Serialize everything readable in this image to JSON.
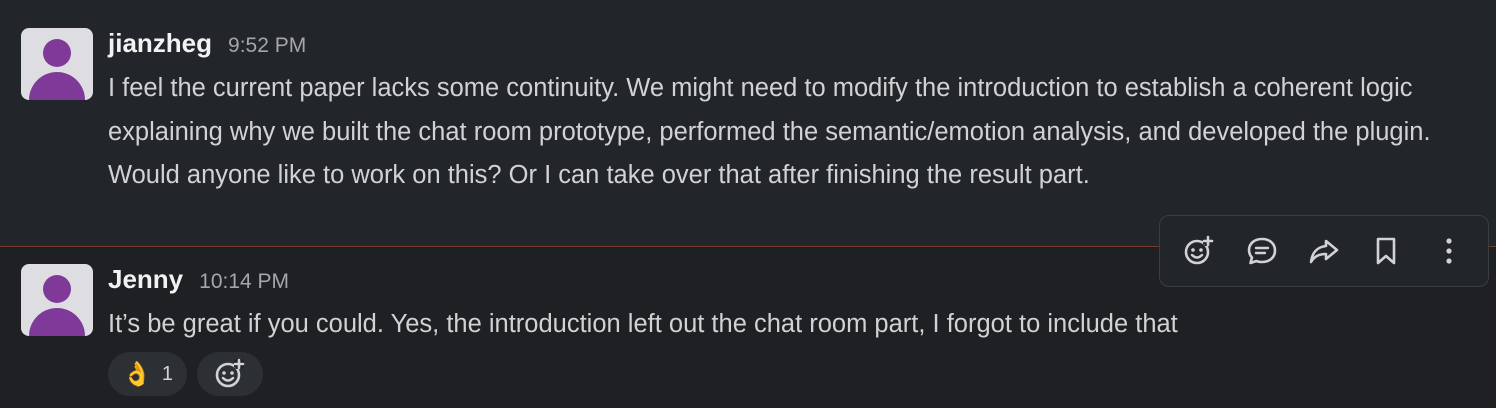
{
  "messages": [
    {
      "author": "jianzheg",
      "time": "9:52 PM",
      "text": "I feel the current paper lacks some continuity. We might need to modify the introduction to establish a coherent logic explaining why we built the chat room prototype, performed the semantic/emotion analysis, and developed the plugin. Would anyone like to work on this? Or I can take over that after finishing the result part."
    },
    {
      "author": "Jenny",
      "time": "10:14 PM",
      "text": "It’s be great if you could. Yes, the introduction left out the chat room part, I forgot to include that",
      "reactions": [
        {
          "emoji": "👌",
          "count": "1"
        }
      ]
    }
  ],
  "toolbar_icons": [
    "add-reaction-icon",
    "reply-in-thread-icon",
    "forward-icon",
    "save-bookmark-icon",
    "more-actions-icon"
  ],
  "colors": {
    "background": "#1a1d21",
    "hover_background": "#222529",
    "avatar_purple": "#7f3a99",
    "divider": "#7a3a2c"
  }
}
